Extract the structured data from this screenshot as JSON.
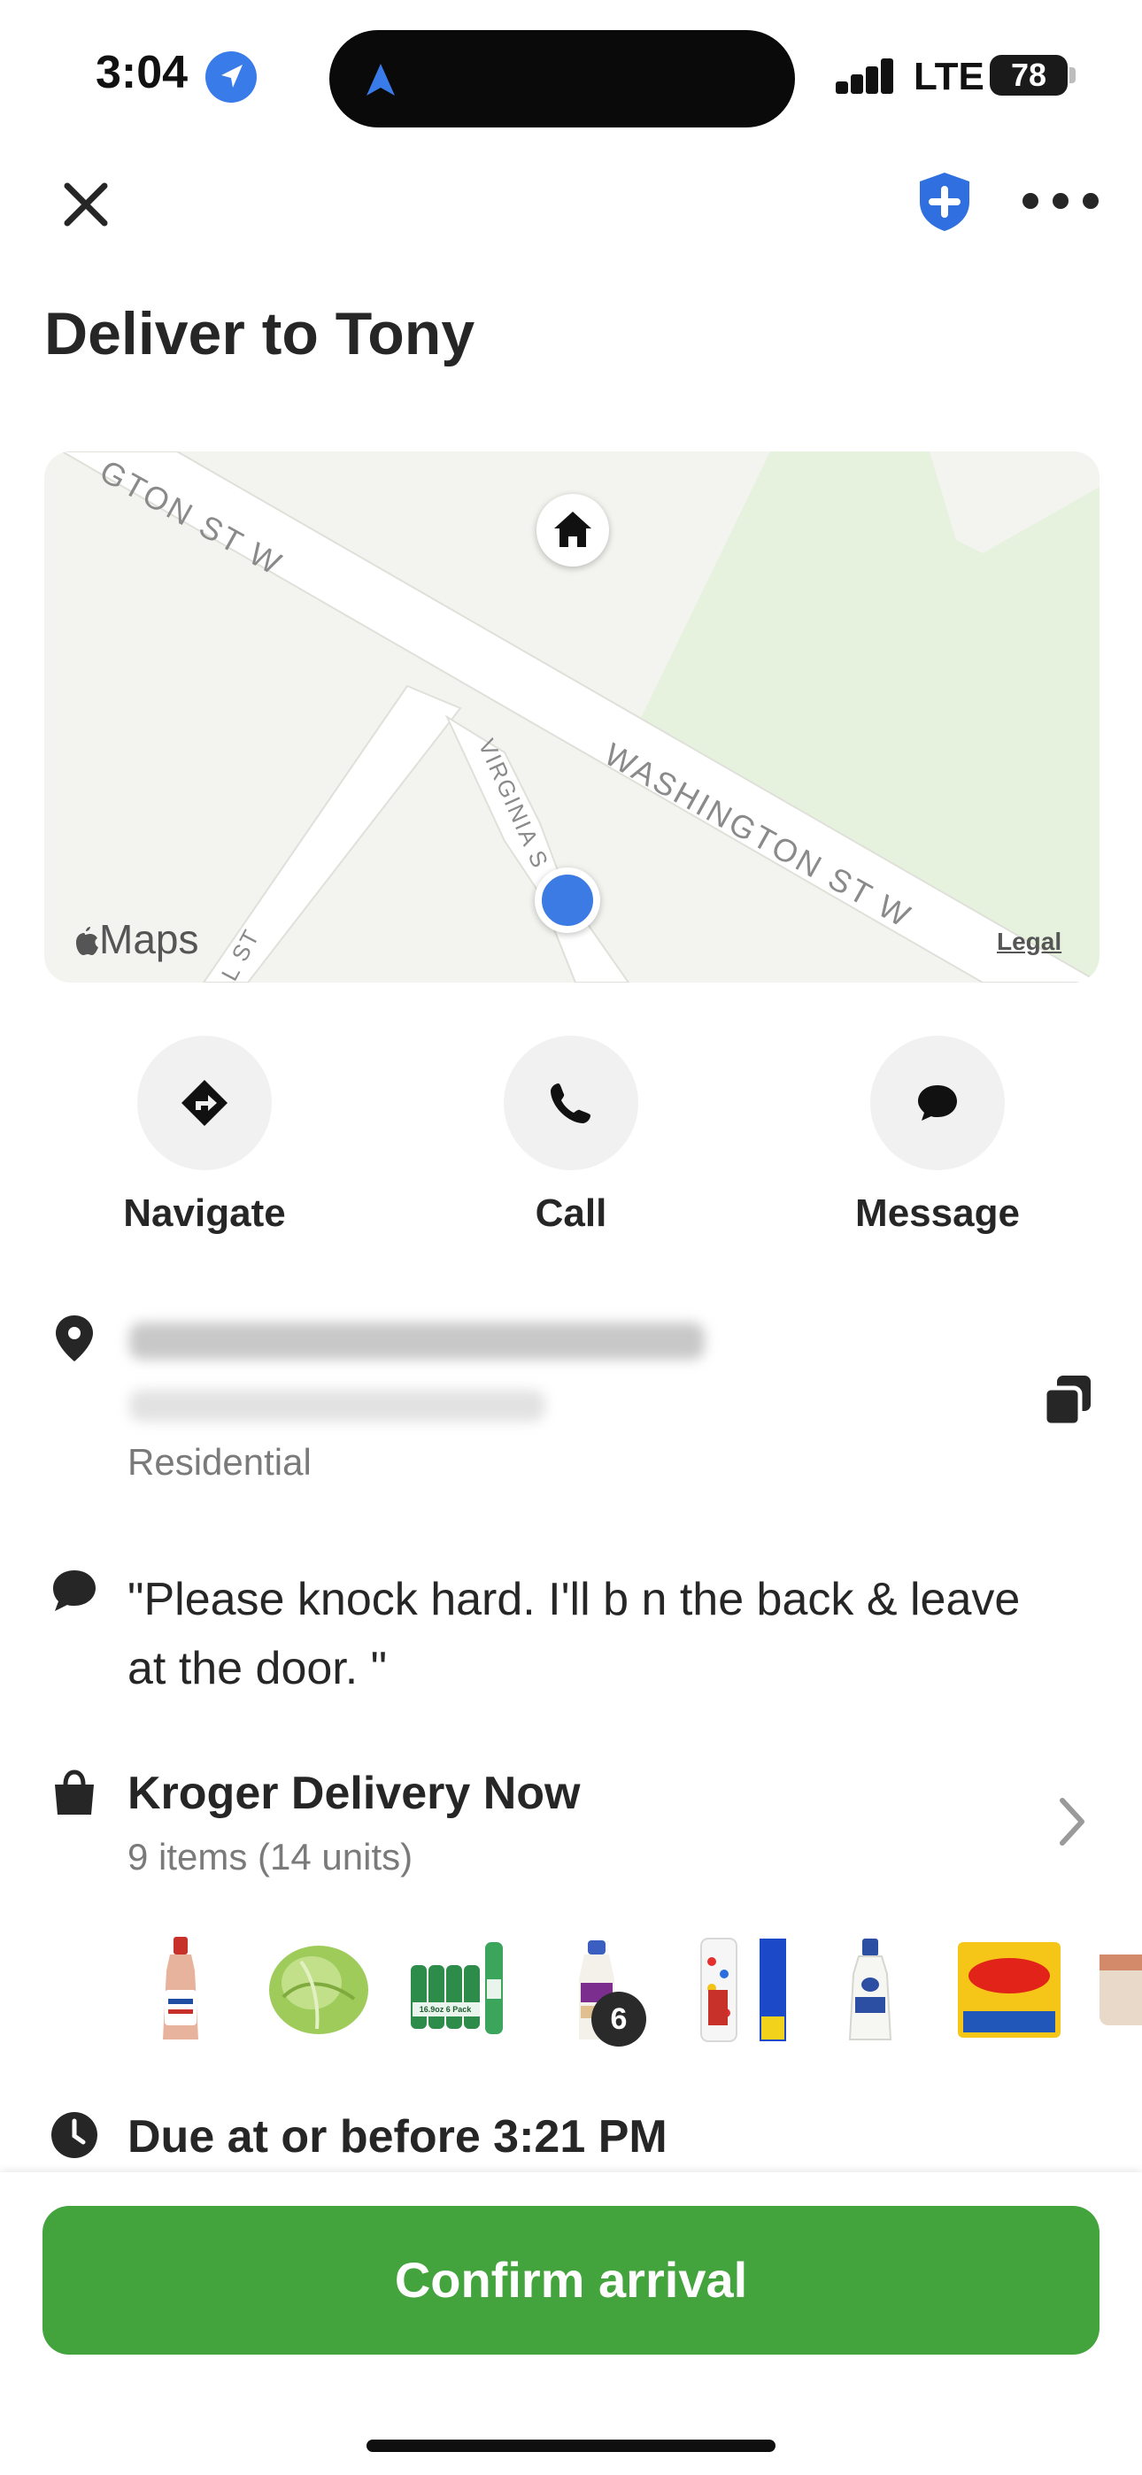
{
  "status_bar": {
    "time": "3:04",
    "carrier": "LTE",
    "battery": "78"
  },
  "header": {
    "title": "Deliver to Tony"
  },
  "map": {
    "street_top": "GTON ST W",
    "street_main": "WASHINGTON ST W",
    "street_side": "VIRGINIA S",
    "street_left": "L ST",
    "brand": "Maps",
    "legal": "Legal"
  },
  "actions": [
    {
      "label": "Navigate",
      "icon": "directions-icon"
    },
    {
      "label": "Call",
      "icon": "phone-icon"
    },
    {
      "label": "Message",
      "icon": "chat-icon"
    }
  ],
  "address": {
    "type": "Residential"
  },
  "note": {
    "text": "\"Please knock hard.  I'll b n the back & leave at the door. \""
  },
  "order": {
    "store": "Kroger Delivery Now",
    "count": "9 items (14 units)",
    "thumbnails": [
      {
        "name": "thousand-island-dressing"
      },
      {
        "name": "lettuce"
      },
      {
        "name": "water-6-pack",
        "text": "16.9oz 6 Pack"
      },
      {
        "name": "coffee-creamer",
        "qty": "6"
      },
      {
        "name": "wonder-bread"
      },
      {
        "name": "ranch-dressing"
      },
      {
        "name": "velveeta-slices"
      },
      {
        "name": "partial-item"
      }
    ]
  },
  "due": {
    "text": "Due at or before 3:21 PM"
  },
  "footer": {
    "button": "Confirm arrival"
  },
  "colors": {
    "accent_green": "#43a33c",
    "location_blue": "#3c7be4",
    "shield_blue": "#2f6fe0"
  }
}
